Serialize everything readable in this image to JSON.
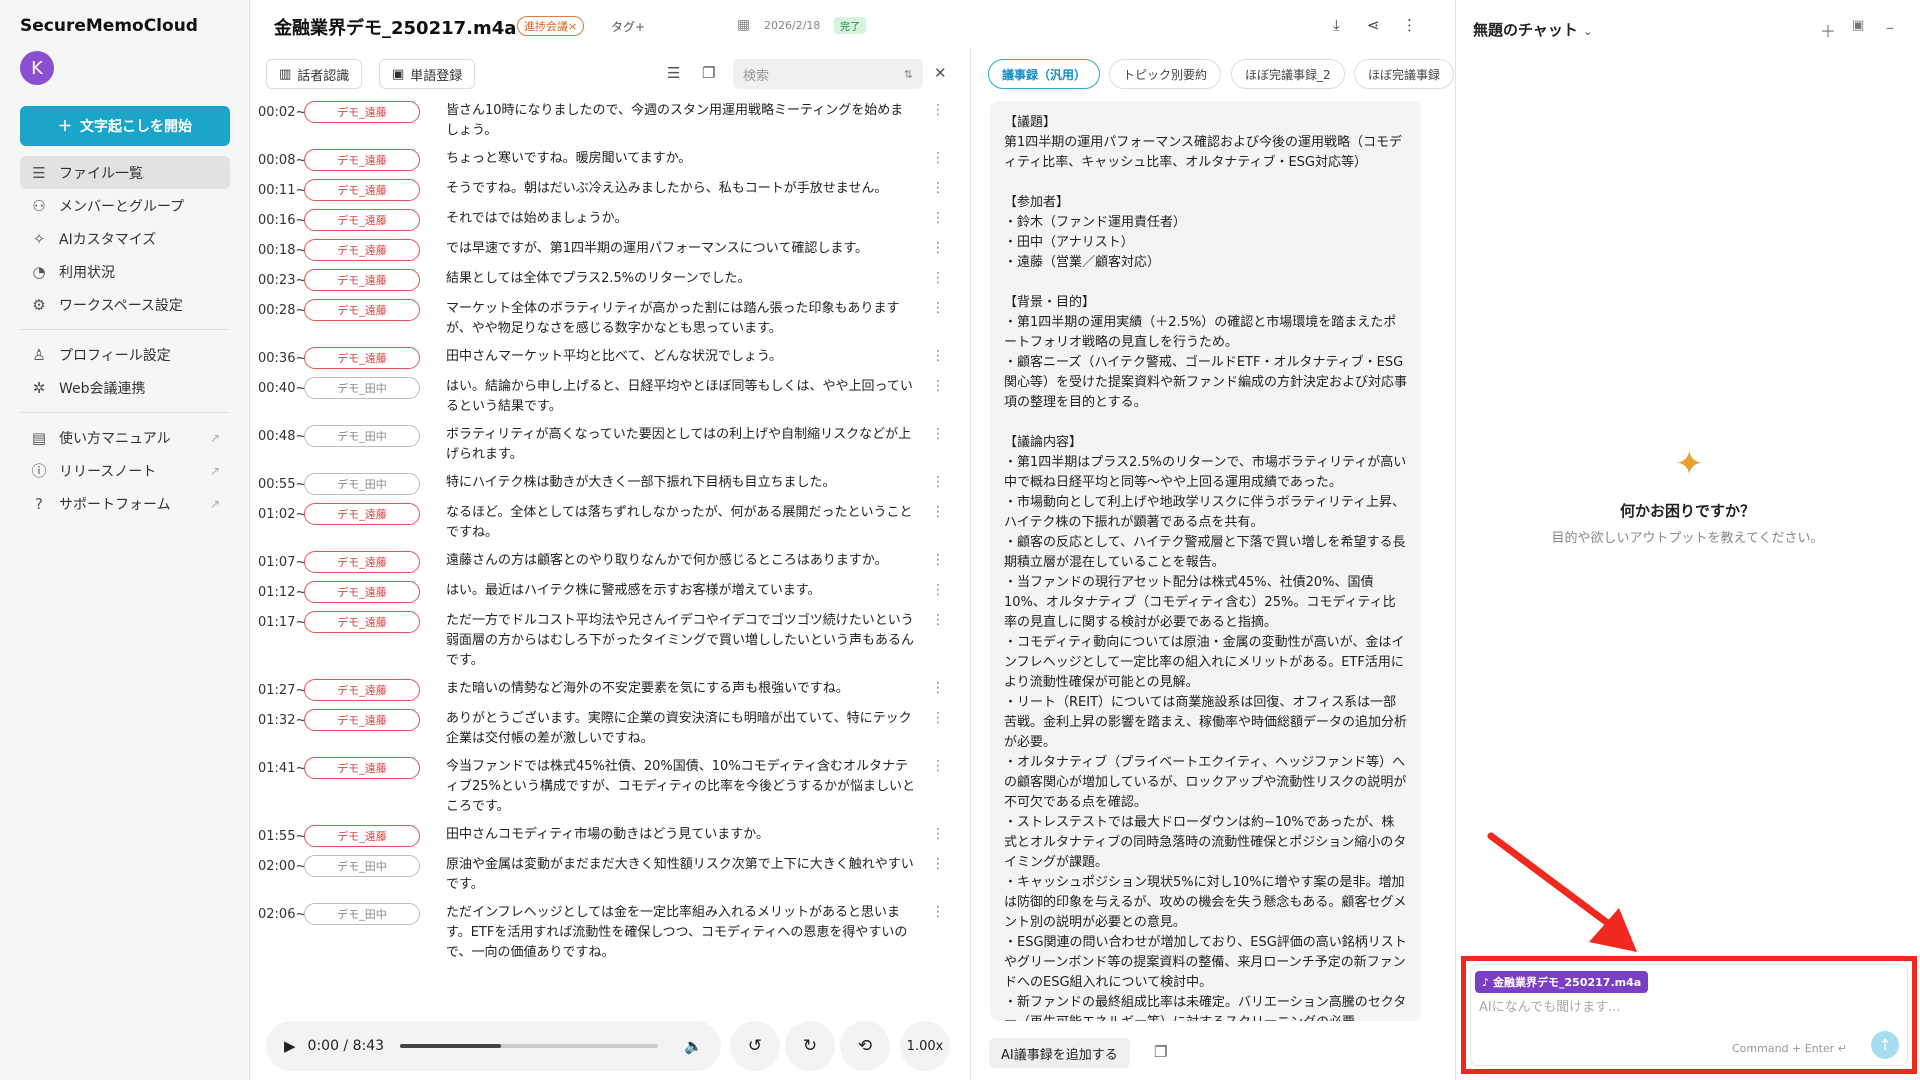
{
  "sidebar": {
    "brand": "SecureMemoCloud",
    "avatar_initial": "K",
    "start_button": "文字起こしを開始",
    "nav_main": [
      {
        "label": "ファイル一覧",
        "icon": "list-icon"
      },
      {
        "label": "メンバーとグループ",
        "icon": "users-icon"
      },
      {
        "label": "AIカスタマイズ",
        "icon": "sparkle-icon"
      },
      {
        "label": "利用状況",
        "icon": "chart-icon"
      },
      {
        "label": "ワークスペース設定",
        "icon": "gear-icon"
      }
    ],
    "nav_account": [
      {
        "label": "プロフィール設定",
        "icon": "user-icon"
      },
      {
        "label": "Web会議連携",
        "icon": "integration-icon"
      }
    ],
    "nav_help": [
      {
        "label": "使い方マニュアル",
        "icon": "book-icon"
      },
      {
        "label": "リリースノート",
        "icon": "info-icon"
      },
      {
        "label": "サポートフォーム",
        "icon": "help-icon"
      }
    ]
  },
  "header": {
    "file_title": "金融業界デモ_250217.m4a",
    "tag": "進捗会議×",
    "tag_add": "タグ+",
    "date": "2026/2/18",
    "status": "完了"
  },
  "transcript_toolbar": {
    "speaker_recognition": "話者認識",
    "word_registration": "単語登録",
    "search_placeholder": "検索"
  },
  "transcript": [
    {
      "time": "00:02~",
      "speaker": "デモ_遠藤",
      "text": "皆さん10時になりましたので、今週のスタン用運用戦略ミーティングを始めましょう。"
    },
    {
      "time": "00:08~",
      "speaker": "デモ_遠藤",
      "text": "ちょっと寒いですね。暖房聞いてますか。"
    },
    {
      "time": "00:11~",
      "speaker": "デモ_遠藤",
      "text": "そうですね。朝はだいぶ冷え込みましたから、私もコートが手放せません。"
    },
    {
      "time": "00:16~",
      "speaker": "デモ_遠藤",
      "text": "それではでは始めましょうか。"
    },
    {
      "time": "00:18~",
      "speaker": "デモ_遠藤",
      "text": "では早速ですが、第1四半期の運用パフォーマンスについて確認します。"
    },
    {
      "time": "00:23~",
      "speaker": "デモ_遠藤",
      "text": "結果としては全体でプラス2.5%のリターンでした。"
    },
    {
      "time": "00:28~",
      "speaker": "デモ_遠藤",
      "text": "マーケット全体のボラティリティが高かった割には踏ん張った印象もありますが、やや物足りなさを感じる数字かなとも思っています。"
    },
    {
      "time": "00:36~",
      "speaker": "デモ_遠藤",
      "text": "田中さんマーケット平均と比べて、どんな状況でしょう。"
    },
    {
      "time": "00:40~",
      "speaker": "デモ_田中",
      "text": "はい。結論から申し上げると、日経平均やとほぼ同等もしくは、やや上回っているという結果です。"
    },
    {
      "time": "00:48~",
      "speaker": "デモ_田中",
      "text": "ボラティリティが高くなっていた要因としてはの利上げや自制縮リスクなどが上げられます。"
    },
    {
      "time": "00:55~",
      "speaker": "デモ_田中",
      "text": "特にハイテク株は動きが大きく一部下振れ下目柄も目立ちました。"
    },
    {
      "time": "01:02~",
      "speaker": "デモ_遠藤",
      "text": "なるほど。全体としては落ちずれしなかったが、何がある展開だったということですね。"
    },
    {
      "time": "01:07~",
      "speaker": "デモ_遠藤",
      "text": "遠藤さんの方は顧客とのやり取りなんかで何か感じるところはありますか。"
    },
    {
      "time": "01:12~",
      "speaker": "デモ_遠藤",
      "text": "はい。最近はハイテク株に警戒感を示すお客様が増えています。"
    },
    {
      "time": "01:17~",
      "speaker": "デモ_遠藤",
      "text": "ただ一方でドルコスト平均法や兄さんイデコやイデコでゴツゴツ続けたいという弱面層の方からはむしろ下がったタイミングで買い増ししたいという声もあるんです。"
    },
    {
      "time": "01:27~",
      "speaker": "デモ_遠藤",
      "text": "また暗いの情勢など海外の不安定要素を気にする声も根強いですね。"
    },
    {
      "time": "01:32~",
      "speaker": "デモ_遠藤",
      "text": "ありがとうございます。実際に企業の資安決済にも明暗が出ていて、特にテック企業は交付帳の差が激しいですね。"
    },
    {
      "time": "01:41~",
      "speaker": "デモ_遠藤",
      "text": "今当ファンドでは株式45%社債、20%国債、10%コモディティ含むオルタナティブ25%という構成ですが、コモディティの比率を今後どうするかが悩ましいところです。"
    },
    {
      "time": "01:55~",
      "speaker": "デモ_遠藤",
      "text": "田中さんコモディティ市場の動きはどう見ていますか。"
    },
    {
      "time": "02:00~",
      "speaker": "デモ_田中",
      "text": "原油や金属は変動がまだまだ大きく知性額リスク次第で上下に大きく触れやすいです。"
    },
    {
      "time": "02:06~",
      "speaker": "デモ_田中",
      "text": "ただインフレヘッジとしては金を一定比率組み入れるメリットがあると思います。ETFを活用すれば流動性を確保しつつ、コモディティへの恩恵を得やすいので、一向の価値ありですね。"
    }
  ],
  "player": {
    "time": "0:00 / 8:43",
    "progress": 0.39,
    "speed": "1.00x"
  },
  "minutes_tabs": [
    "議事録（汎用）",
    "トピック別要約",
    "ほぼ完議事録_2",
    "ほぼ完議事録"
  ],
  "minutes_text": "【議題】\n第1四半期の運用パフォーマンス確認および今後の運用戦略（コモディティ比率、キャッシュ比率、オルタナティブ・ESG対応等）\n\n【参加者】\n・鈴木（ファンド運用責任者）\n・田中（アナリスト）\n・遠藤（営業／顧客対応）\n\n【背景・目的】\n・第1四半期の運用実績（＋2.5%）の確認と市場環境を踏まえたポートフォリオ戦略の見直しを行うため。\n・顧客ニーズ（ハイテク警戒、ゴールドETF・オルタナティブ・ESG関心等）を受けた提案資料や新ファンド編成の方針決定および対応事項の整理を目的とする。\n\n【議論内容】\n・第1四半期はプラス2.5%のリターンで、市場ボラティリティが高い中で概ね日経平均と同等〜やや上回る運用成績であった。\n・市場動向として利上げや地政学リスクに伴うボラティリティ上昇、ハイテク株の下振れが顕著である点を共有。\n・顧客の反応として、ハイテク警戒層と下落で買い増しを希望する長期積立層が混在していることを報告。\n・当ファンドの現行アセット配分は株式45%、社債20%、国債10%、オルタナティブ（コモディティ含む）25%。コモディティ比率の見直しに関する検討が必要であると指摘。\n・コモディティ動向については原油・金属の変動性が高いが、金はインフレヘッジとして一定比率の組入れにメリットがある。ETF活用により流動性確保が可能との見解。\n・リート（REIT）については商業施設系は回復、オフィス系は一部苦戦。金利上昇の影響を踏まえ、稼働率や時価総額データの追加分析が必要。\n・オルタナティブ（プライベートエクイティ、ヘッジファンド等）への顧客関心が増加しているが、ロックアップや流動性リスクの説明が不可欠である点を確認。\n・ストレステストでは最大ドローダウンは約−10%であったが、株式とオルタナティブの同時急落時の流動性確保とポジション縮小のタイミングが課題。\n・キャッシュポジション現状5%に対し10%に増やす案の是非。増加は防御的印象を与えるが、攻めの機会を失う懸念もある。顧客セグメント別の説明が必要との意見。\n・ESG関連の問い合わせが増加しており、ESG評価の高い銘柄リストやグリーンボンド等の提案資料の整備、来月ローンチ予定の新ファンドへのESG組入れについて検討中。\n・新ファンドの最終組成比率は未確定。バリエーション高騰のセクター（再生可能エネルギー等）に対するスクリーニングの必要",
  "minutes_footer": {
    "add_minutes": "AI議事録を追加する"
  },
  "chat": {
    "title": "無題のチャット",
    "help_title": "何かお困りですか？",
    "help_sub": "目的や欲しいアウトプットを教えてください。",
    "attachment": "金融業界デモ_250217.m4a",
    "input_placeholder": "AIになんでも聞けます...",
    "shortcut": "Command + Enter"
  },
  "colors": {
    "accent": "#1aa5c9",
    "speaker_red": "#e05656",
    "highlight": "#f0281e",
    "attach_chip": "#7b3fc6"
  }
}
